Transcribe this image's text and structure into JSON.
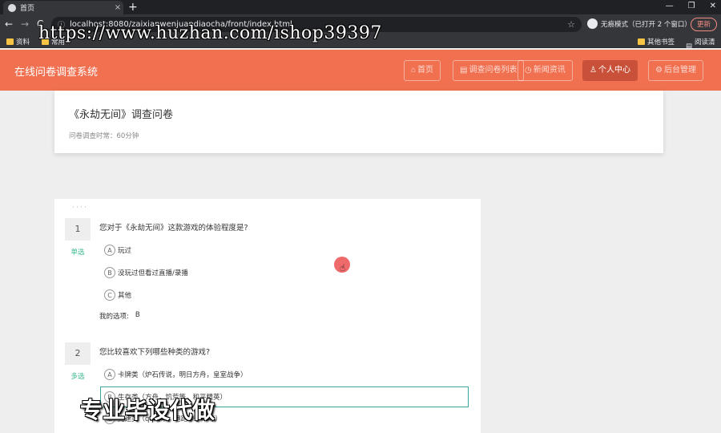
{
  "browser": {
    "tab_title": "首页",
    "tab_close": "×",
    "new_tab": "+",
    "window_controls": [
      "—",
      "❐",
      "✕"
    ],
    "nav_back": "←",
    "nav_forward": "→",
    "nav_reload": "C",
    "url_info_icon": "ⓘ",
    "url": "localhost:8080/zaixianwenjuandiaocha/front/index.html",
    "star": "☆",
    "incognito_text": "无痕模式（已打开 2 个窗口）",
    "update_label": "更新",
    "bookmarks": [
      "资料",
      "常用"
    ],
    "bookmarks_right": [
      "其他书签",
      "阅读清单"
    ]
  },
  "watermark_url": "https://www.huzhan.com/ishop39397",
  "watermark_cn": "专业毕设代做",
  "site": {
    "title": "在线问卷调查系统",
    "nav": [
      {
        "icon": "⌂",
        "label": "首页"
      },
      {
        "icon": "▤",
        "label": "调查问卷列表"
      },
      {
        "icon": "◷",
        "label": "新闻资讯"
      },
      {
        "icon": "♙",
        "label": "个人中心"
      },
      {
        "icon": "⚙",
        "label": "后台管理"
      }
    ]
  },
  "survey": {
    "title": "《永劫无间》调查问卷",
    "time_label": "问卷调查时常：60分钟",
    "dots": "· · · ·"
  },
  "questions": [
    {
      "number": "1",
      "type": "单选",
      "text": "您对于《永劫无间》这款游戏的体验程度是?",
      "options": [
        {
          "letter": "A",
          "text": "玩过"
        },
        {
          "letter": "B",
          "text": "没玩过但看过直播/录播"
        },
        {
          "letter": "C",
          "text": "其他"
        }
      ],
      "my_choice_label": "我的选项:",
      "my_choice_value": "B"
    },
    {
      "number": "2",
      "type": "多选",
      "text": "您比较喜欢下列哪些种类的游戏?",
      "options": [
        {
          "letter": "A",
          "text": "卡牌类（炉石传说，明日方舟，皇室战争）"
        },
        {
          "letter": "B",
          "text": "生存类（方舟，饥荒等，和平精英）"
        },
        {
          "letter": "C",
          "text": "竞速类（qq飞车，跑跑卡丁车等）"
        }
      ]
    }
  ]
}
